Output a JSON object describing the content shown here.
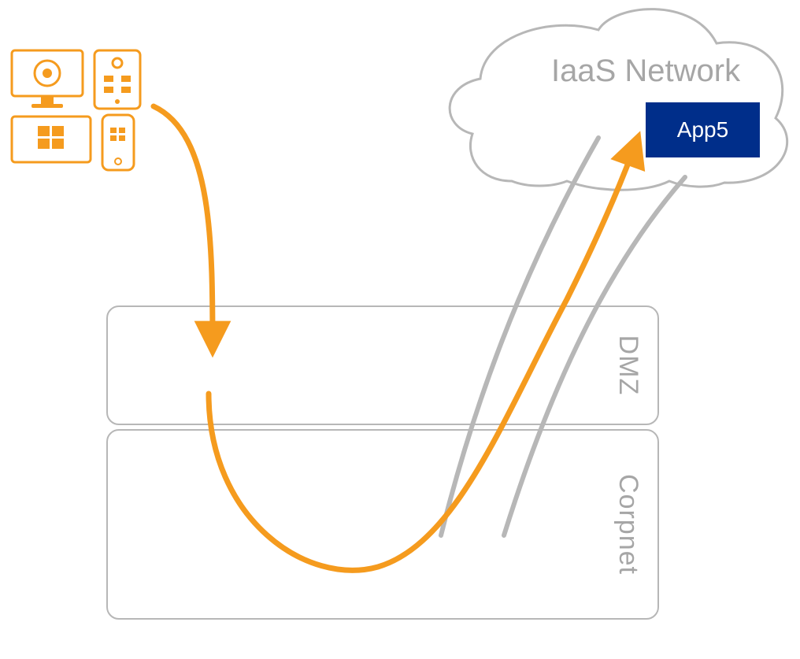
{
  "cloud": {
    "label": "IaaS Network"
  },
  "app": {
    "label": "App5"
  },
  "zones": {
    "dmz": {
      "label": "DMZ"
    },
    "corpnet": {
      "label": "Corpnet"
    }
  },
  "colors": {
    "orange": "#f59b1e",
    "grey": "#b7b7b7",
    "greyText": "#a6a6a6",
    "appBlue": "#002e8a"
  }
}
